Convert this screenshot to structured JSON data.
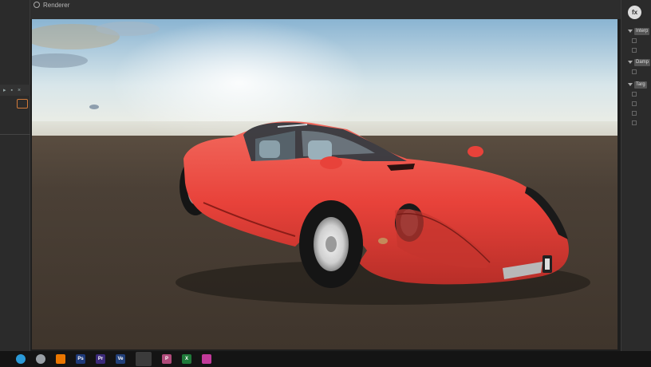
{
  "window": {
    "title": "Renderer"
  },
  "right_panel": {
    "fx_label": "fx",
    "sections": [
      {
        "label": "Interp"
      },
      {
        "label": "Damp"
      },
      {
        "label": "Targ"
      }
    ]
  },
  "taskbar": {
    "apps": [
      {
        "name": "edge-icon",
        "label": "",
        "color": "#2b9ad8"
      },
      {
        "name": "chrome-icon",
        "label": "",
        "color": "#9aa0a6"
      },
      {
        "name": "blender-icon",
        "label": "",
        "color": "#ea7600"
      },
      {
        "name": "photoshop-icon",
        "label": "Ps",
        "color": "#1e3a7a"
      },
      {
        "name": "premiere-icon",
        "label": "Pr",
        "color": "#3b2a7a"
      },
      {
        "name": "vegas-icon",
        "label": "Ve",
        "color": "#22407a"
      },
      {
        "name": "renderer-icon",
        "label": "",
        "color": "#888888",
        "active": true
      },
      {
        "name": "p-app-icon",
        "label": "P",
        "color": "#b04a7a"
      },
      {
        "name": "excel-icon",
        "label": "X",
        "color": "#1f7a3a"
      },
      {
        "name": "file-icon",
        "label": "",
        "color": "#c23a9a"
      }
    ]
  },
  "colors": {
    "car_body": "#e8423a",
    "sky_top": "#8ab4d2",
    "ground": "#4a4036"
  }
}
